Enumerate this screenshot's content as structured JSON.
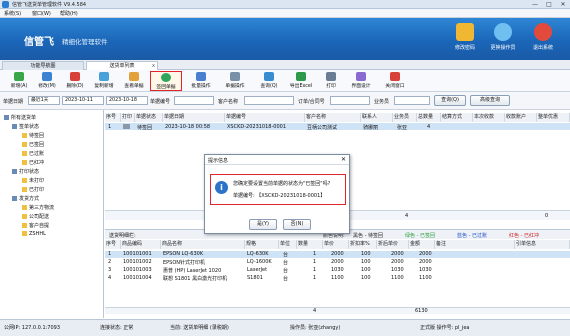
{
  "window": {
    "title": "信管飞送货单管理软件 V9.4.584",
    "min": "—",
    "max": "□",
    "close": "✕"
  },
  "menu": [
    "系统(S)",
    "窗口(W)",
    "帮助(H)"
  ],
  "banner": {
    "brand": "信管飞",
    "slogan": "精细化管理软件",
    "actions": [
      {
        "label": "修改密码",
        "icon": "lock-icon",
        "color": "#f0b733"
      },
      {
        "label": "更换操作员",
        "icon": "user-switch-icon",
        "color": "#6fc0f0"
      },
      {
        "label": "退出系统",
        "icon": "exit-icon",
        "color": "#e24a3b"
      }
    ]
  },
  "tabs": [
    {
      "label": "功能导航图"
    },
    {
      "label": "送货单列表",
      "close": "x"
    }
  ],
  "toolbar": [
    {
      "label": "新增(A)",
      "color": "#3aa64a"
    },
    {
      "label": "修改(M)",
      "color": "#3b82d2"
    },
    {
      "label": "删除(D)",
      "color": "#d9423b"
    },
    {
      "label": "复制新增",
      "color": "#4aa0d8"
    },
    {
      "label": "查看单据",
      "color": "#e3a13b"
    },
    {
      "label": "签回单据",
      "color": "#2fa65a"
    },
    {
      "label": "批量操作",
      "color": "#4a7fd0"
    },
    {
      "label": "单据操作",
      "color": "#7a8fa8"
    },
    {
      "label": "查询(Q)",
      "color": "#3a8cd0"
    },
    {
      "label": "导出Excel",
      "color": "#2c9a4a"
    },
    {
      "label": "打印",
      "color": "#6a7d93"
    },
    {
      "label": "界面设计",
      "color": "#8a6ad0"
    },
    {
      "label": "关闭窗口",
      "color": "#d9423b"
    }
  ],
  "filter": {
    "date_label": "单据日期",
    "date_mode": "最近1天",
    "date_from": "2023-10-11",
    "date_to": "2023-10-18",
    "doc_label": "单据编号",
    "customer_label": "客户名称",
    "order_label": "订单/合同号",
    "salesman_label": "业务员",
    "query_btn": "查询(Q)",
    "adv_btn": "高级查询"
  },
  "tree": [
    {
      "label": "所有送货单",
      "level": 0,
      "color": "#6a8bb8"
    },
    {
      "label": "签单状态",
      "level": 1,
      "color": "#6a8bb8"
    },
    {
      "label": "待签回",
      "level": 2,
      "color": "#f0c040"
    },
    {
      "label": "已签回",
      "level": 2,
      "color": "#f0c040"
    },
    {
      "label": "已过账",
      "level": 2,
      "color": "#f0c040"
    },
    {
      "label": "已红冲",
      "level": 2,
      "color": "#f0c040"
    },
    {
      "label": "打印状态",
      "level": 1,
      "color": "#6a8bb8"
    },
    {
      "label": "未打印",
      "level": 2,
      "color": "#f0c040"
    },
    {
      "label": "已打印",
      "level": 2,
      "color": "#f0c040"
    },
    {
      "label": "发货方式",
      "level": 1,
      "color": "#6a8bb8"
    },
    {
      "label": "第三方物流",
      "level": 2,
      "color": "#f0c040"
    },
    {
      "label": "公司配送",
      "level": 2,
      "color": "#f0c040"
    },
    {
      "label": "客户自提",
      "level": 2,
      "color": "#f0c040"
    },
    {
      "label": "ZSHHL",
      "level": 2,
      "color": "#f0c040"
    }
  ],
  "grid": {
    "headers": [
      "序号",
      "打印",
      "单据状态",
      "单据日期",
      "单据编号",
      "客户名称",
      "联系人",
      "业务员",
      "总数量",
      "结算方式",
      "本次收款",
      "收款账户",
      "整单优惠"
    ],
    "rows": [
      [
        "1",
        "",
        "待签回",
        "2023-10-18 00:58",
        "XSCKD-20231018-0001",
        "豆柄公司测试",
        "骑娜丽",
        "张亚",
        "4",
        "",
        "",
        "",
        ""
      ]
    ],
    "footer_qty": "4",
    "footer_total": "0"
  },
  "detail": {
    "title": "送货明细栏:",
    "legend": [
      {
        "label": "颜色说明:",
        "color": "#333"
      },
      {
        "label": "黑色 - 待签回",
        "color": "#222"
      },
      {
        "label": "绿色 - 已签回",
        "color": "#2a9a3a"
      },
      {
        "label": "蓝色 - 已过账",
        "color": "#2050c8"
      },
      {
        "label": "红色 - 已红冲",
        "color": "#d02020"
      }
    ],
    "headers": [
      "序号",
      "商品编码",
      "商品名称",
      "规格",
      "单位",
      "数量",
      "单价",
      "折扣率%",
      "折后单价",
      "金额",
      "备注",
      "引单信息"
    ],
    "rows": [
      [
        "1",
        "100101001",
        "EPSON LQ-630K",
        "LQ-630K",
        "台",
        "1",
        "2000",
        "100",
        "2000",
        "2000",
        "",
        ""
      ],
      [
        "2",
        "100101002",
        "EPSON针式打印机",
        "LQ-1600K",
        "台",
        "1",
        "2000",
        "100",
        "2000",
        "2000",
        "",
        ""
      ],
      [
        "3",
        "100101003",
        "惠普 (HP) LaserJet 1020",
        "LaserJet",
        "台",
        "1",
        "1030",
        "100",
        "1030",
        "1030",
        "",
        ""
      ],
      [
        "4",
        "100101004",
        "联想 S1801 黑白激光打印机",
        "S1801",
        "台",
        "1",
        "1100",
        "100",
        "1100",
        "1100",
        "",
        ""
      ]
    ],
    "footer_qty": "4",
    "footer_total": "6130"
  },
  "status": {
    "ip": "公网IP: 127.0.0.1:7093",
    "connection": "连接状态: 正常",
    "current": "当前: 送货单明细 (录税期)",
    "operator": "操作员: 张亚(zhangy)",
    "version": "正式版 操作号: pl_jea"
  },
  "dialog": {
    "title": "提示信息",
    "close": "✕",
    "message": "您确定要设置当前单据的状态为\"已签回\"吗?",
    "doc": "单据编号: 【XSCKD-20231018-0001】",
    "yes": "是(Y)",
    "no": "否(N)"
  }
}
